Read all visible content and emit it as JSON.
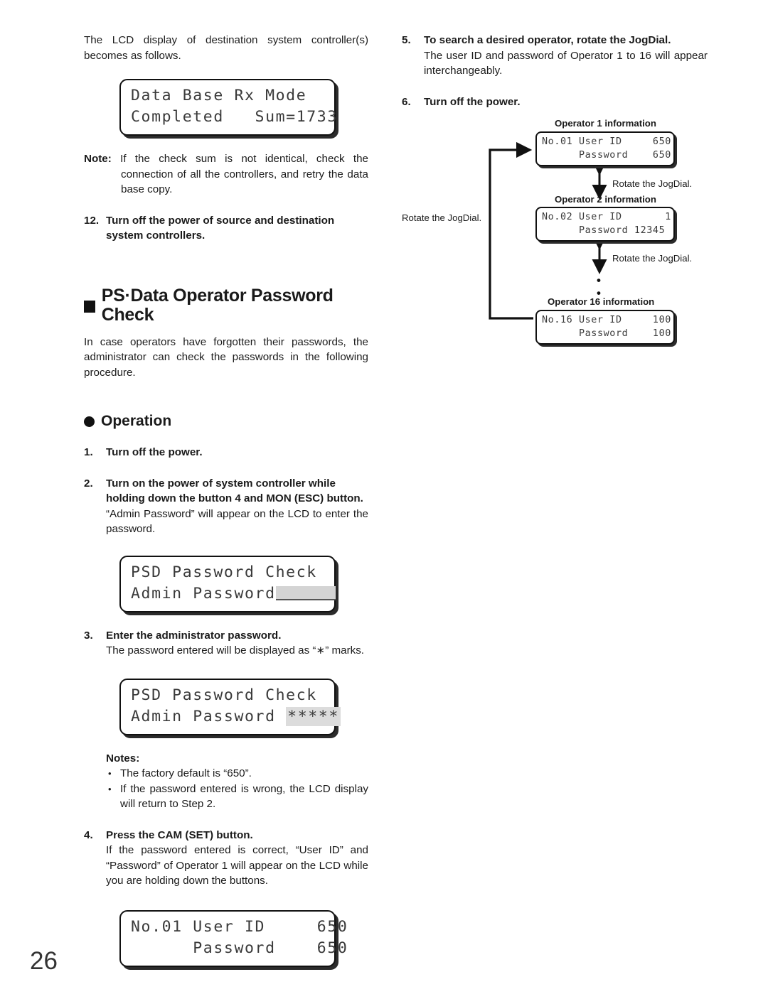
{
  "page": {
    "number": "26"
  },
  "left": {
    "intro_paragraph": "The LCD display of destination system controller(s) becomes as follows.",
    "lcd_rx_mode": {
      "line1": "Data Base Rx Mode",
      "line2": "Completed   Sum=1733"
    },
    "note": {
      "label": "Note:",
      "text": "If the check sum is not identical, check the connection of all the controllers, and retry the data base copy."
    },
    "step12": {
      "num": "12.",
      "head": "Turn off the power of source and destination system controllers."
    },
    "section_heading": "PS·Data Operator Password Check",
    "section_paragraph": "In case operators have forgotten their passwords, the administrator can check the passwords in the following procedure.",
    "operation_heading": "Operation",
    "step1": {
      "num": "1.",
      "head": "Turn off the power."
    },
    "step2": {
      "num": "2.",
      "head": "Turn on the power of system controller while holding down the button 4 and MON (ESC) button.",
      "body": "“Admin Password” will appear on the LCD to enter the password."
    },
    "lcd_admin_blank": {
      "line1": "PSD Password Check",
      "line2_label": "Admin Password"
    },
    "step3": {
      "num": "3.",
      "head": "Enter the administrator password.",
      "body": "The password entered will be displayed as “∗” marks."
    },
    "lcd_admin_stars": {
      "line1": "PSD Password Check",
      "line2_label": "Admin Password",
      "line2_value": "*****"
    },
    "notes": {
      "title": "Notes:",
      "items": [
        "The factory default is “650”.",
        "If the password entered is wrong, the LCD display will return to Step 2."
      ]
    },
    "step4": {
      "num": "4.",
      "head": "Press the CAM (SET) button.",
      "body": "If the password entered is correct, “User ID” and “Password” of Operator 1 will appear on the LCD while you are holding down the buttons."
    },
    "lcd_operator1": {
      "line1": "No.01 User ID     650",
      "line2": "      Password    650"
    }
  },
  "right": {
    "step5": {
      "num": "5.",
      "head": "To search a desired operator, rotate the JogDial.",
      "body": "The user ID and password of Operator 1 to 16 will appear interchangeably."
    },
    "step6": {
      "num": "6.",
      "head": "Turn off the power."
    },
    "diagram": {
      "operator1_label": "Operator 1 information",
      "operator1_line1": "No.01 User ID     650",
      "operator1_line2": "      Password    650",
      "operator2_label": "Operator 2 information",
      "operator2_line1": "No.02 User ID       1",
      "operator2_line2": "      Password 12345",
      "operator16_label": "Operator 16  information",
      "operator16_line1": "No.16 User ID     100",
      "operator16_line2": "      Password    100",
      "rotate_note_1": "Rotate the JogDial.",
      "rotate_note_2": "Rotate the JogDial.",
      "rotate_note_loop": "Rotate the JogDial."
    }
  }
}
